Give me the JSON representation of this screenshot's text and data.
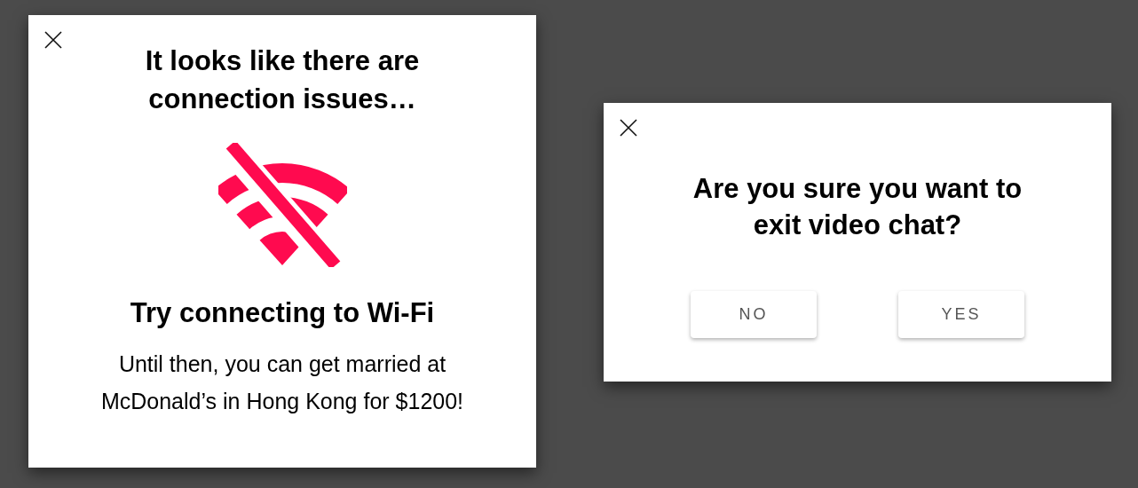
{
  "dialogs": [
    {
      "kind": "connection",
      "title": "It looks like there are connection issues…",
      "heading": "Try connecting to Wi-Fi",
      "message": "Until then, you can get married at McDonald’s in Hong Kong for $1200!"
    },
    {
      "kind": "confirm",
      "title": "Are you sure you want to exit video chat?",
      "buttons": [
        "NO",
        "YES"
      ]
    }
  ]
}
